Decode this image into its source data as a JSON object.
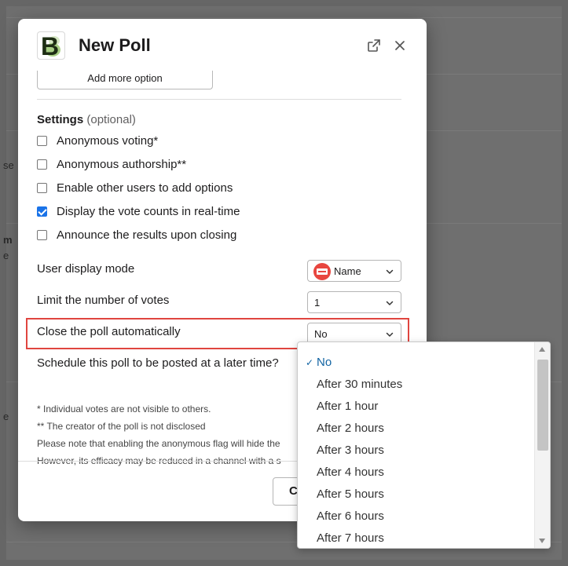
{
  "background": {
    "fragments": [
      "se",
      "m",
      "e",
      "e"
    ]
  },
  "modal": {
    "title": "New Poll",
    "logo_letter": "B",
    "add_option_label": "Add more option",
    "settings": {
      "heading": "Settings",
      "heading_suffix": "(optional)",
      "options": [
        {
          "label": "Anonymous voting*",
          "checked": false
        },
        {
          "label": "Anonymous authorship**",
          "checked": false
        },
        {
          "label": "Enable other users to add options",
          "checked": false
        },
        {
          "label": "Display the vote counts in real-time",
          "checked": true
        },
        {
          "label": "Announce the results upon closing",
          "checked": false
        }
      ]
    },
    "fields": {
      "user_display_mode": {
        "label": "User display mode",
        "value": "Name"
      },
      "limit_votes": {
        "label": "Limit the number of votes",
        "value": "1"
      },
      "close_automatically": {
        "label": "Close the poll automatically",
        "value": "No"
      },
      "schedule": {
        "label": "Schedule this poll to be posted at a later time?"
      }
    },
    "notes": [
      "* Individual votes are not visible to others.",
      "** The creator of the poll is not disclosed",
      "Please note that enabling the anonymous flag will hide the",
      "However, its efficacy may be reduced in a channel with a s"
    ],
    "close_button_label": "C"
  },
  "dropdown": {
    "options": [
      {
        "label": "No",
        "selected": true
      },
      {
        "label": "After 30 minutes",
        "selected": false
      },
      {
        "label": "After 1 hour",
        "selected": false
      },
      {
        "label": "After 2 hours",
        "selected": false
      },
      {
        "label": "After 3 hours",
        "selected": false
      },
      {
        "label": "After 4 hours",
        "selected": false
      },
      {
        "label": "After 5 hours",
        "selected": false
      },
      {
        "label": "After 6 hours",
        "selected": false
      },
      {
        "label": "After 7 hours",
        "selected": false
      }
    ],
    "selected_mark": "✓"
  },
  "colors": {
    "highlight": "#e0453f",
    "accent": "#1264a3",
    "checkbox": "#1a73e8"
  }
}
